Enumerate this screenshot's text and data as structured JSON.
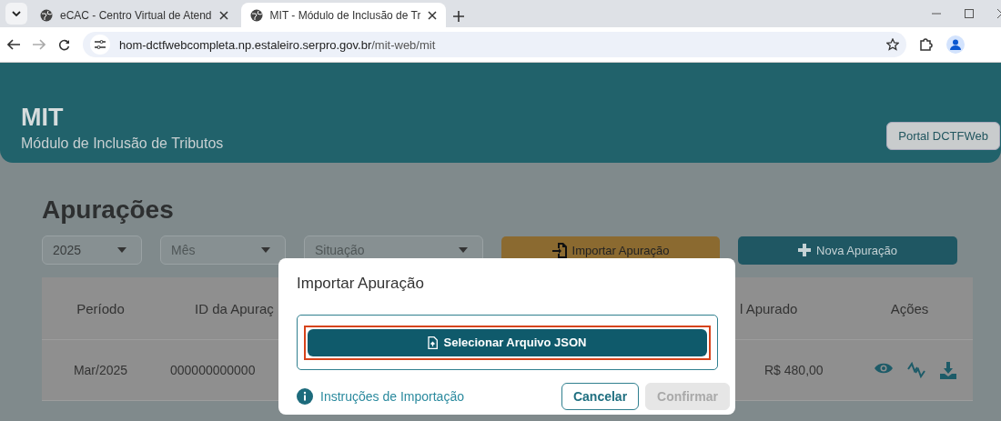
{
  "browser": {
    "tabs": [
      {
        "title": "eCAC - Centro Virtual de Atend",
        "selected": false
      },
      {
        "title": "MIT - Módulo de Inclusão de Tr",
        "selected": true
      }
    ],
    "url_host": "hom-dctfwebcompleta.np.estaleiro.serpro.gov.br",
    "url_path": "/mit-web/mit"
  },
  "header": {
    "title": "MIT",
    "subtitle": "Módulo de Inclusão de Tributos",
    "portal_button": "Portal DCTFWeb"
  },
  "page": {
    "heading": "Apurações",
    "filters": [
      {
        "value": "2025"
      },
      {
        "placeholder": "Mês"
      },
      {
        "placeholder": "Situação"
      }
    ],
    "import_button": "Importar Apuração",
    "new_button": "Nova Apuração",
    "table": {
      "columns": [
        "Período",
        "ID da Apuraç",
        "l Apurado",
        "Ações"
      ],
      "rows": [
        {
          "period": "Mar/2025",
          "id": "000000000000",
          "total": "R$ 480,00"
        }
      ]
    }
  },
  "dialog": {
    "title": "Importar Apuração",
    "select_button": "Selecionar Arquivo JSON",
    "highlighted": true,
    "help_link": "Instruções de Importação",
    "buttons": [
      {
        "label": "Cancelar",
        "disabled": false
      },
      {
        "label": "Confirmar",
        "disabled": true
      }
    ]
  }
}
